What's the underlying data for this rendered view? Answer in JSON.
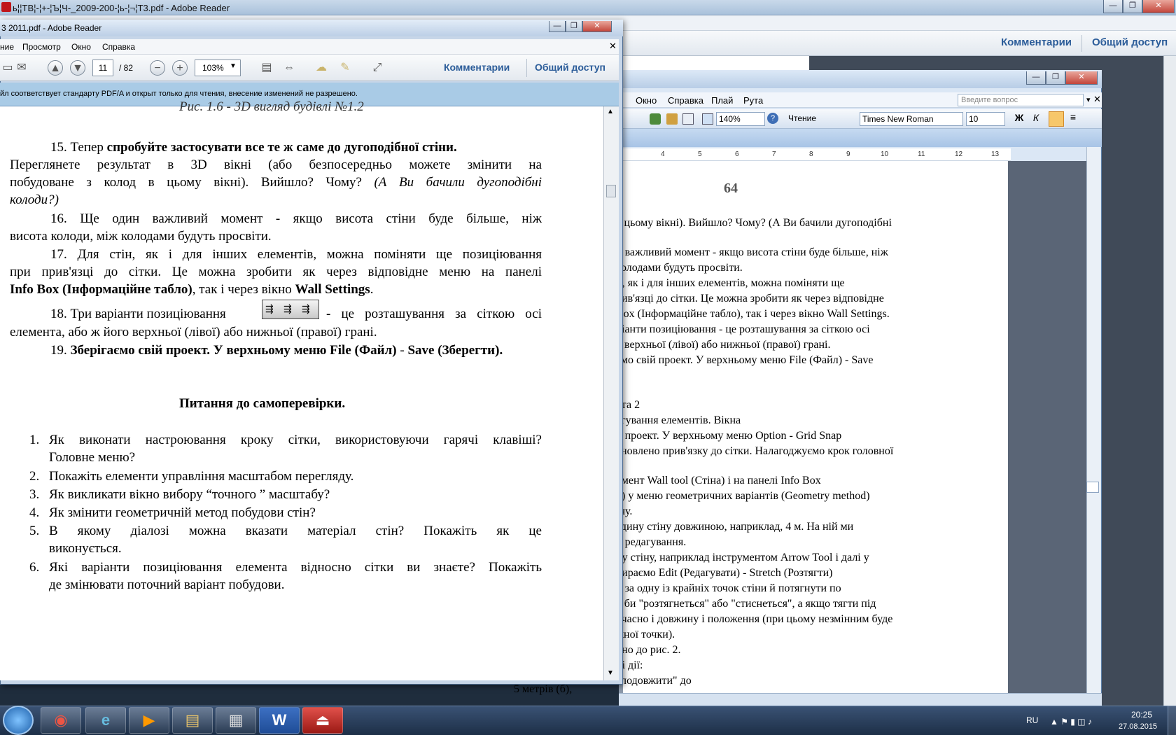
{
  "background_reader": {
    "title": "ь¦¦ТВ¦-¦+-¦Ъ¦Ч-_2009-200-¦ь-¦¬¦Т3.pdf - Adobe Reader",
    "comments": "Комментарии",
    "share": "Общий доступ"
  },
  "word": {
    "menu": [
      "Окно",
      "Справка",
      "Плай",
      "Рута"
    ],
    "ask_placeholder": "Введите вопрос",
    "zoom": "140%",
    "reading": "Чтение",
    "font": "Times New Roman",
    "size": "10",
    "bold": "Ж",
    "italic": "К",
    "ruler": [
      "4",
      "5",
      "6",
      "7",
      "8",
      "9",
      "10",
      "11",
      "12",
      "13"
    ],
    "page_number": "64",
    "lines": [
      "в цьому вікні). Вийшло? Чому? (А Ви бачили дугоподібні",
      "н важливий момент - якщо висота стіни буде більше, ніж",
      "колодами будуть просвіти.",
      "и, як і для інших елементів, можна поміняти ще",
      "рив'язці до сітки. Це можна зробити як через відповідне",
      "Box (Інформаційне табло), так і через вікно Wall Settings.",
      "ріанти позиціювання - це розташування за сіткою осі",
      "о верхньої (лівої) або нижньої (правої) грані.",
      "ємо свій проект. У верхньому меню File (Файл) - Save",
      "ота 2",
      "агування елементів. Вікна",
      "й проект. У верхньому меню Option - Grid Snap",
      "ановлено прив'язку до сітки. Налагоджуємо крок головної",
      "умент Wall tool (Стіна) і на панелі Info Box",
      "о) у меню геометричних варіантів (Geometry method)",
      "іну.",
      "едину стіну довжиною, наприклад, 4 м. На ній ми",
      "и редагування.",
      "ну стіну, наприклад інструментом Arrow Tool і далі у",
      "бираємо Edit (Редагувати) - Stretch (Розтягти)",
      "и за одну із крайніх точок стіни й потягнути по",
      "к би \"розтягнеться\" або \"стиснеться\", а якщо тягти під",
      "очасно і довжину і положення (при цьому незмінним буде",
      "жної точки).",
      "дно до рис. 2.",
      "ні дії:",
      "\"подовжити\" до",
      "5 метрів (б),"
    ]
  },
  "reader": {
    "title": "3 2011.pdf - Adobe Reader",
    "menu": [
      "ние",
      "Просмотр",
      "Окно",
      "Справка"
    ],
    "page_current": "11",
    "page_total": "/ 82",
    "zoom": "103%",
    "comments": "Комментарии",
    "share": "Общий доступ",
    "notice": "йл соответствует стандарту PDF/A и открыт только для чтения, внесение изменений не разрешено.",
    "top_cut": "Рис. 1.6 - 3D вигляд будівлі №1.2",
    "p15_a": "15. Тепер",
    "p15_b": "спробуйте застосувати все те ж саме до дугоподібної стіни.",
    "p15_l2": "Переглянете результат в 3D вікні (або безпосередньо можете змінити на",
    "p15_l3a": "побудоване з колод в цьому вікні). Вийшло? Чому?",
    "p15_l3b": "(А Ви бачили дугоподібні",
    "p15_l4": "колоди?)",
    "p16_l1": "16. Ще один важливий момент - якщо висота стіни буде більше, ніж",
    "p16_l2": "висота колоди, між колодами будуть просвіти.",
    "p17_l1": "17. Для стін, як і для інших елементів, можна поміняти ще позиціювання",
    "p17_l2": "при прив'язці до сітки. Це можна зробити як через відповідне меню на панелі",
    "p17_l3a": "Info Box (Інформаційне табло)",
    "p17_l3b": ", так і через вікно",
    "p17_l3c": "Wall Settings",
    "p17_l3d": ".",
    "p18_a": "18. Три варіанти позиціювання",
    "p18_b": "- це розташування за сіткою осі",
    "p18_l2": "елемента, або ж його верхньої (лівої) або нижньої (правої) грані.",
    "p19_a": "19.",
    "p19_b": "Зберігаємо свій проект. У верхньому меню File (Файл)",
    "p19_c": "-",
    "p19_d": "Save (Зберегти).",
    "questions_title": "Питання до самоперевірки.",
    "questions": [
      {
        "n": "1.",
        "l1": "Як виконати настроювання кроку сітки, використовуючи гарячі клавіші?",
        "l2": "Головне меню?"
      },
      {
        "n": "2.",
        "l1": "Покажіть елементи управління масштабом перегляду.",
        "l2": ""
      },
      {
        "n": "3.",
        "l1": "Як викликати вікно вибору “точного ” масштабу?",
        "l2": ""
      },
      {
        "n": "4.",
        "l1": "Як змінити геометричній метод побудови стін?",
        "l2": ""
      },
      {
        "n": "5.",
        "l1": "В якому діалозі можна вказати матеріал стін? Покажіть як це",
        "l2": "виконується."
      },
      {
        "n": "6.",
        "l1": "Які варіанти позиціювання елемента відносно сітки ви знаєте? Покажіть",
        "l2": "де змінювати поточний варіант побудови."
      }
    ]
  },
  "taskbar": {
    "lang": "RU",
    "time": "20:25",
    "date": "27.08.2015"
  }
}
